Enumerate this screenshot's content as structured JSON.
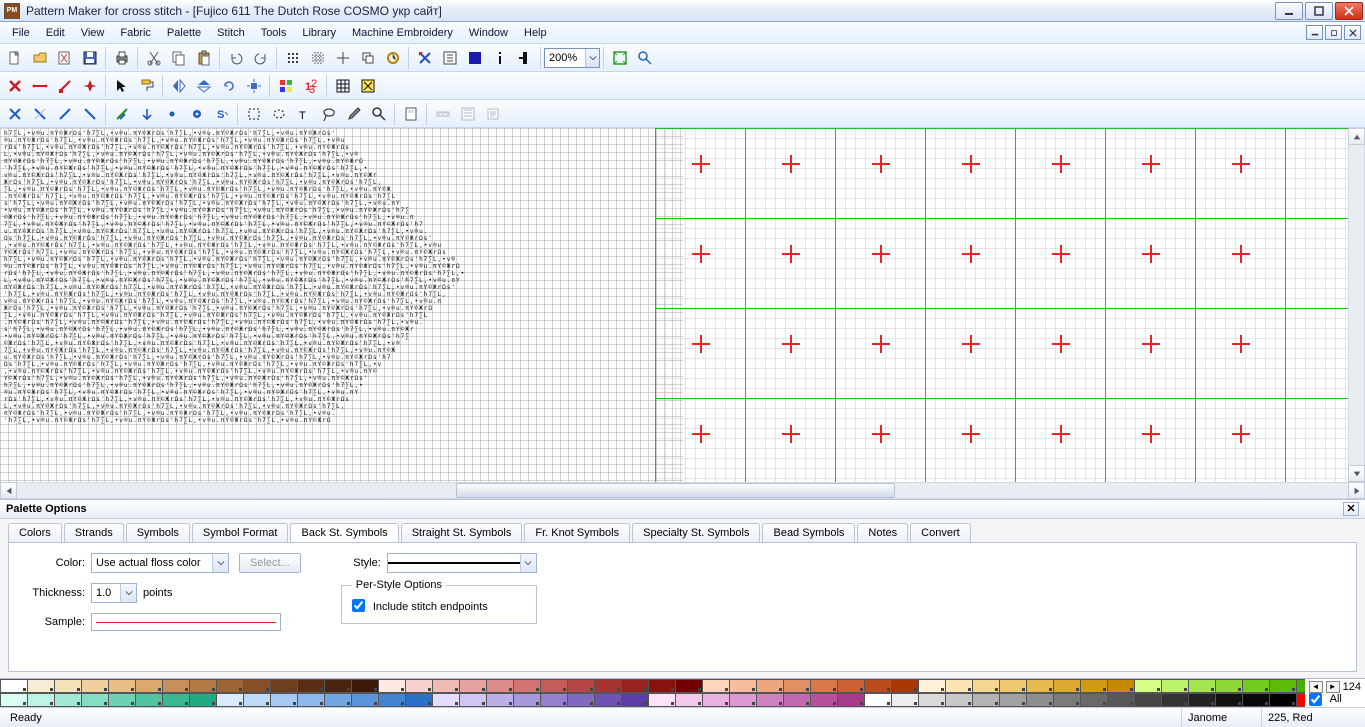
{
  "titlebar": {
    "appIcon": "PM",
    "title": "Pattern Maker for cross stitch - [Fujico 611 The Dutch Rose COSMO укр сайт]"
  },
  "menu": {
    "items": [
      "File",
      "Edit",
      "View",
      "Fabric",
      "Palette",
      "Stitch",
      "Tools",
      "Library",
      "Machine Embroidery",
      "Window",
      "Help"
    ]
  },
  "toolbar1": {
    "zoom": "200%"
  },
  "panel": {
    "title": "Palette Options",
    "closeIcon": "✕",
    "tabs": [
      "Colors",
      "Strands",
      "Symbols",
      "Symbol Format",
      "Back St. Symbols",
      "Straight St. Symbols",
      "Fr. Knot Symbols",
      "Specialty St. Symbols",
      "Bead Symbols",
      "Notes",
      "Convert"
    ],
    "activeTab": 4,
    "backst": {
      "colorLabel": "Color:",
      "colorValue": "Use actual floss color",
      "selectBtn": "Select...",
      "thickLabel": "Thickness:",
      "thickValue": "1.0",
      "thickUnits": "points",
      "sampleLabel": "Sample:",
      "styleLabel": "Style:",
      "perStyleTitle": "Per-Style Options",
      "includeEndpoints": "Include stitch endpoints",
      "includeChecked": true
    }
  },
  "palette": {
    "row1": [
      "#ffffff",
      "#f7edd6",
      "#f4e2b8",
      "#f0d19e",
      "#e9bd86",
      "#dba870",
      "#c6905b",
      "#b37947",
      "#9e6435",
      "#855027",
      "#6f3e1d",
      "#5a2e14",
      "#4b240f",
      "#3b1a0a",
      "#ffe8e2",
      "#f8d2cc",
      "#f0bbb6",
      "#e7a39f",
      "#dd8b88",
      "#d17371",
      "#c55c5b",
      "#b74746",
      "#a83432",
      "#97221f",
      "#87120e",
      "#730000",
      "#ffd4bc",
      "#f6bd9e",
      "#eda681",
      "#e28f65",
      "#d6784a",
      "#c96132",
      "#bb4c1c",
      "#aa3807",
      "#fff1d7",
      "#fbe4b3",
      "#f5d690",
      "#eec86e",
      "#e6b94d",
      "#dcaa2f",
      "#d29a12",
      "#c68900",
      "#d6ff85",
      "#bdf36a",
      "#a4e650",
      "#8cd937",
      "#74cb20",
      "#5dbc0a",
      "#47ad00",
      "#339d00"
    ],
    "row2": [
      "#d7fff4",
      "#bcf4e5",
      "#a1e9d5",
      "#86ddc5",
      "#6cd1b5",
      "#52c4a4",
      "#38b793",
      "#1faa82",
      "#d9eaff",
      "#bfdaf9",
      "#a5c9f2",
      "#8cb8eb",
      "#73a7e3",
      "#5a95db",
      "#4383d2",
      "#2c71c9",
      "#e5dcff",
      "#d1c5f4",
      "#bdaee8",
      "#a997dc",
      "#9580cf",
      "#8169c2",
      "#6e53b4",
      "#5b3ea5",
      "#ffe1fb",
      "#f5c9ee",
      "#e9b1e0",
      "#dd99d1",
      "#d081c1",
      "#c369b1",
      "#b5519f",
      "#a73a8c",
      "#ffffff",
      "#ededed",
      "#dadada",
      "#c7c7c7",
      "#b4b4b4",
      "#a1a1a1",
      "#8e8e8e",
      "#7b7b7b",
      "#696969",
      "#575757",
      "#454545",
      "#333333",
      "#222222",
      "#111111",
      "#0a0a0a",
      "#000000",
      "#ff0000",
      "#ff0000"
    ],
    "count": "124",
    "allLabel": "All",
    "allChecked": true
  },
  "status": {
    "ready": "Ready",
    "machine": "Janome",
    "color": "225, Red"
  }
}
